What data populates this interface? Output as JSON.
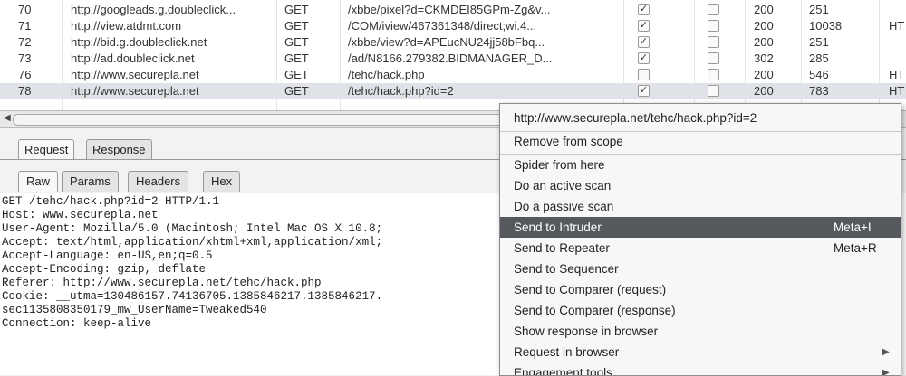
{
  "history": {
    "rows": [
      {
        "num": "70",
        "host": "http://googleads.g.doubleclick...",
        "method": "GET",
        "url": "/xbbe/pixel?d=CKMDEI85GPm-Zg&v...",
        "c1": "✓",
        "c2": "",
        "status": "200",
        "length": "251",
        "mime": ""
      },
      {
        "num": "71",
        "host": "http://view.atdmt.com",
        "method": "GET",
        "url": "/COM/iview/467361348/direct;wi.4...",
        "c1": "✓",
        "c2": "",
        "status": "200",
        "length": "10038",
        "mime": "HT"
      },
      {
        "num": "72",
        "host": "http://bid.g.doubleclick.net",
        "method": "GET",
        "url": "/xbbe/view?d=APEucNU24jj58bFbq...",
        "c1": "✓",
        "c2": "",
        "status": "200",
        "length": "251",
        "mime": ""
      },
      {
        "num": "73",
        "host": "http://ad.doubleclick.net",
        "method": "GET",
        "url": "/ad/N8166.279382.BIDMANAGER_D...",
        "c1": "✓",
        "c2": "",
        "status": "302",
        "length": "285",
        "mime": ""
      },
      {
        "num": "76",
        "host": "http://www.securepla.net",
        "method": "GET",
        "url": "/tehc/hack.php",
        "c1": "",
        "c2": "",
        "status": "200",
        "length": "546",
        "mime": "HT"
      },
      {
        "num": "78",
        "host": "http://www.securepla.net",
        "method": "GET",
        "url": "/tehc/hack.php?id=2",
        "c1": "✓",
        "c2": "",
        "status": "200",
        "length": "783",
        "mime": "HT"
      }
    ]
  },
  "tabs": {
    "request": "Request",
    "response": "Response"
  },
  "subtabs": {
    "raw": "Raw",
    "params": "Params",
    "headers": "Headers",
    "hex": "Hex"
  },
  "raw_request": [
    "GET /tehc/hack.php?id=2 HTTP/1.1",
    "Host: www.securepla.net",
    "User-Agent: Mozilla/5.0 (Macintosh; Intel Mac OS X 10.8;",
    "Accept: text/html,application/xhtml+xml,application/xml;",
    "Accept-Language: en-US,en;q=0.5",
    "Accept-Encoding: gzip, deflate",
    "Referer: http://www.securepla.net/tehc/hack.php",
    "Cookie: __utma=130486157.74136705.1385846217.1385846217.",
    "sec1135808350179_mw_UserName=Tweaked540",
    "Connection: keep-alive"
  ],
  "context_menu": {
    "header": "http://www.securepla.net/tehc/hack.php?id=2",
    "remove_scope": "Remove from scope",
    "spider": "Spider from here",
    "active_scan": "Do an active scan",
    "passive_scan": "Do a passive scan",
    "intruder": "Send to Intruder",
    "intruder_shortcut": "Meta+I",
    "repeater": "Send to Repeater",
    "repeater_shortcut": "Meta+R",
    "sequencer": "Send to Sequencer",
    "comparer_req": "Send to Comparer (request)",
    "comparer_resp": "Send to Comparer (response)",
    "show_response": "Show response in browser",
    "request_browser": "Request in browser",
    "engagement": "Engagement tools",
    "submenu_arrow": "▶"
  }
}
